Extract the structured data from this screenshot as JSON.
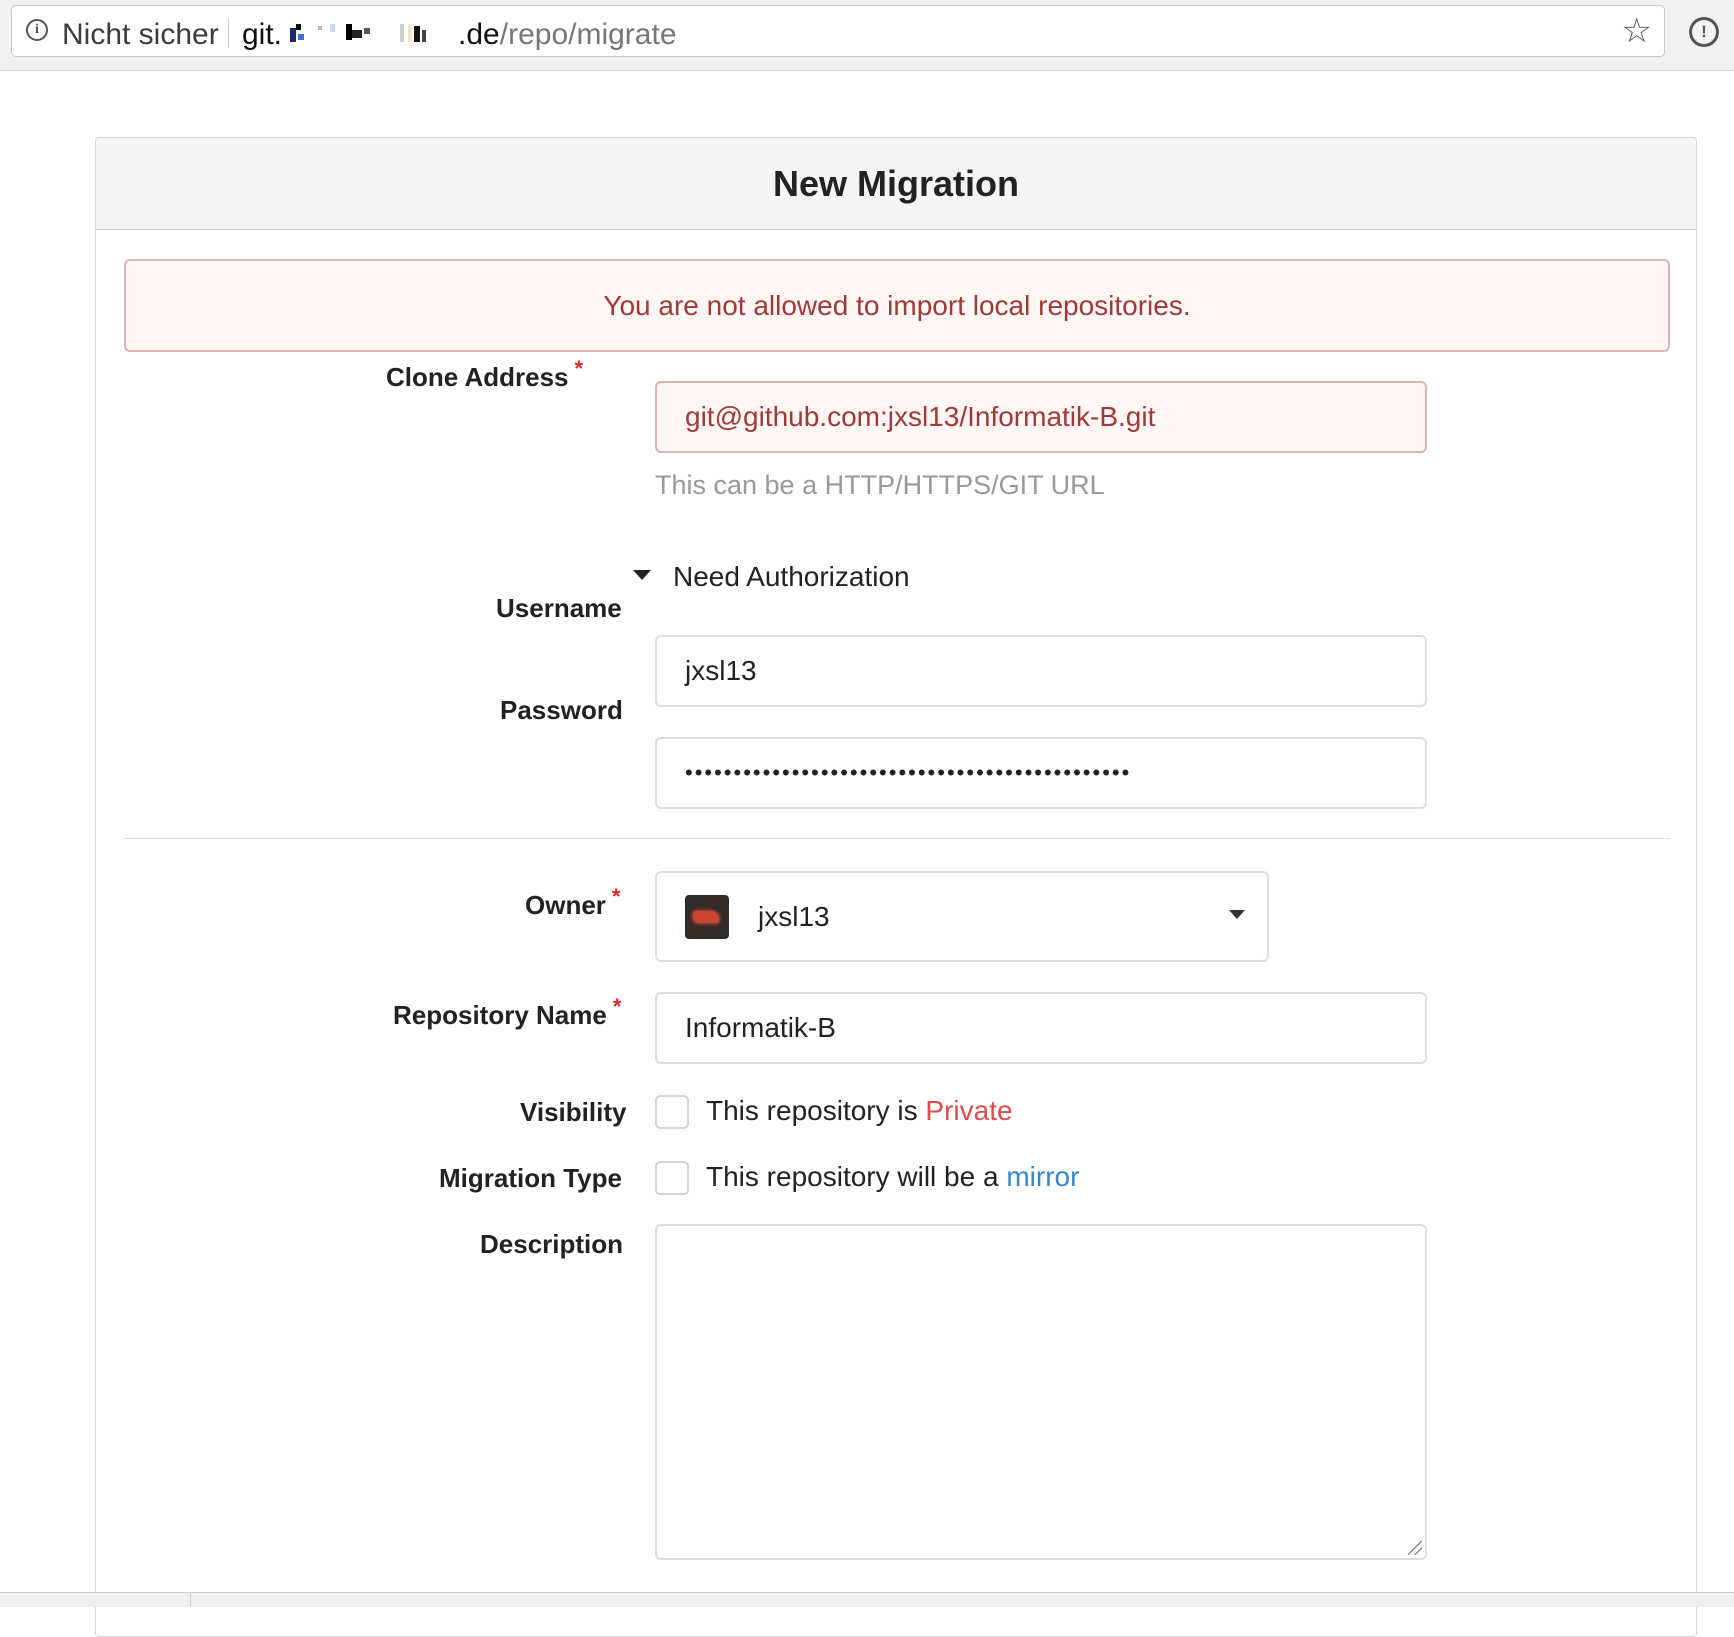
{
  "browser": {
    "security_label": "Nicht sicher",
    "url_prefix": "git.",
    "url_domain_suffix": ".de",
    "url_path": "/repo/migrate",
    "icons": [
      "info-icon",
      "bookmark-star-icon",
      "extension-icon"
    ]
  },
  "form": {
    "title": "New Migration",
    "error_message": "You are not allowed to import local repositories.",
    "clone_address": {
      "label": "Clone Address",
      "required_mark": "*",
      "value": "git@github.com:jxsl13/Informatik-B.git",
      "hint": "This can be a HTTP/HTTPS/GIT URL"
    },
    "auth_toggle_label": "Need Authorization",
    "username": {
      "label": "Username",
      "value": "jxsl13"
    },
    "password": {
      "label": "Password",
      "masked_value": "••••••••••••••••••••••••••••••••••••••••••••••"
    },
    "owner": {
      "label": "Owner",
      "required_mark": "*",
      "value": "jxsl13"
    },
    "repo_name": {
      "label": "Repository Name",
      "required_mark": "*",
      "value": "Informatik-B"
    },
    "visibility": {
      "label": "Visibility",
      "text": "This repository is ",
      "highlight": "Private",
      "checked": false
    },
    "migration_type": {
      "label": "Migration Type",
      "text": "This repository will be a ",
      "highlight": "mirror",
      "checked": false
    },
    "description": {
      "label": "Description",
      "value": ""
    }
  },
  "colors": {
    "error_text": "#9f3a38",
    "error_bg": "#fff6f6",
    "error_border": "#e0b4b4",
    "required": "#db2828",
    "private": "#db4d4d",
    "mirror_link": "#3a87c8"
  }
}
